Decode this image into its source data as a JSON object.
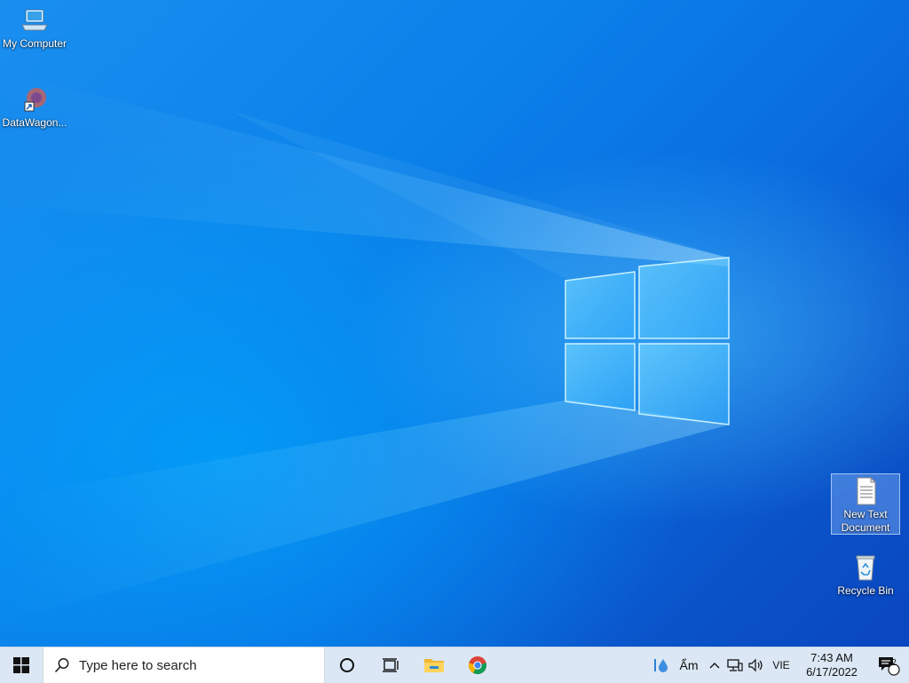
{
  "desktop": {
    "icons": [
      {
        "label": "My Computer",
        "icon": "computer-icon"
      },
      {
        "label": "DataWagon...",
        "icon": "datawagon-shortcut-icon"
      },
      {
        "label": "New Text Document",
        "icon": "text-document-icon",
        "selected": true
      },
      {
        "label": "Recycle Bin",
        "icon": "recycle-bin-icon"
      }
    ]
  },
  "taskbar": {
    "search_placeholder": "Type here to search",
    "apps": [
      "cortana-icon",
      "task-view-icon",
      "file-explorer-icon",
      "chrome-icon"
    ],
    "tray": {
      "ime_label": "Ẩm",
      "language": "VIE",
      "time": "7:43 AM",
      "date": "6/17/2022",
      "notification_count": "2"
    }
  },
  "colors": {
    "wallpaper": "#0a6fdc",
    "taskbar": "#dbe7f4",
    "accent": "#1a8ff0"
  }
}
